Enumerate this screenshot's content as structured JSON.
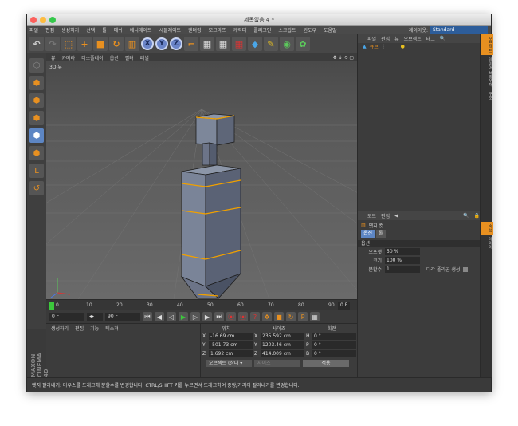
{
  "window": {
    "title": "제목없음 4 *"
  },
  "menu": {
    "items": [
      "파일",
      "편집",
      "생성하기",
      "선택",
      "툴",
      "메쉬",
      "애니메이트",
      "시뮬레이트",
      "렌더링",
      "모그라프",
      "캐릭터",
      "플러그인",
      "스크립트",
      "윈도우",
      "도움말"
    ],
    "layout_label": "레이아웃:",
    "layout_value": "Standard"
  },
  "toolbar": {
    "x_label": "X",
    "y_label": "Y",
    "z_label": "Z"
  },
  "viewport": {
    "menu": [
      "뷰",
      "카메라",
      "디스플레이",
      "옵션",
      "필터",
      "패널"
    ],
    "label": "3D 뷰"
  },
  "timeline": {
    "ticks": [
      "0",
      "10",
      "20",
      "30",
      "40",
      "50",
      "60",
      "70",
      "80",
      "90"
    ],
    "current_frame": "0 F",
    "start_frame": "0 F",
    "end_frame": "90 F"
  },
  "material_manager": {
    "menu": [
      "생성하기",
      "편집",
      "기능",
      "텍스쳐"
    ],
    "brand": "MAXON CINEMA 4D"
  },
  "coordinates": {
    "headers": [
      "위치",
      "사이즈",
      "회전"
    ],
    "rows": [
      {
        "axis": "X",
        "pos": "-16.69 cm",
        "size_axis": "X",
        "size": "235.592 cm",
        "rot_axis": "H",
        "rot": "0 °"
      },
      {
        "axis": "Y",
        "pos": "-501.73 cm",
        "size_axis": "Y",
        "size": "1203.46 cm",
        "rot_axis": "P",
        "rot": "0 °"
      },
      {
        "axis": "Z",
        "pos": "1.692 cm",
        "size_axis": "Z",
        "size": "414.009 cm",
        "rot_axis": "B",
        "rot": "0 °"
      }
    ],
    "mode": "오브젝트 (상대 ▾",
    "size_mode": "사이즈",
    "apply": "적용"
  },
  "object_manager": {
    "menu": [
      "파일",
      "편집",
      "뷰",
      "오브젝트",
      "태그"
    ],
    "object_name": "큐브"
  },
  "attributes": {
    "menu": [
      "모드",
      "편집"
    ],
    "title": "엣지 컷",
    "tabs": [
      "옵션",
      "툴"
    ],
    "section": "옵션",
    "fields": [
      {
        "label": "오프셋",
        "value": "50 %"
      },
      {
        "label": "크기",
        "value": "100 %"
      },
      {
        "label": "분할수",
        "value": "1"
      }
    ],
    "checkbox_label": "다각 폴리곤 생성"
  },
  "right_tabs": [
    "오브젝트",
    "레이어 브라우저",
    "구조"
  ],
  "right_tabs_lower": [
    "속성",
    "레이어"
  ],
  "status": {
    "text": "엣지 잘라내기: 마우스를 드래그해 분할수를 변경합니다. CTRL/SHIFT 키를 누르면서 드래그하여 중앙/거리의 잘라내기를 변경합니다."
  },
  "colors": {
    "accent": "#e89020",
    "selection": "#5d86c4",
    "edge": "#f0a000"
  }
}
